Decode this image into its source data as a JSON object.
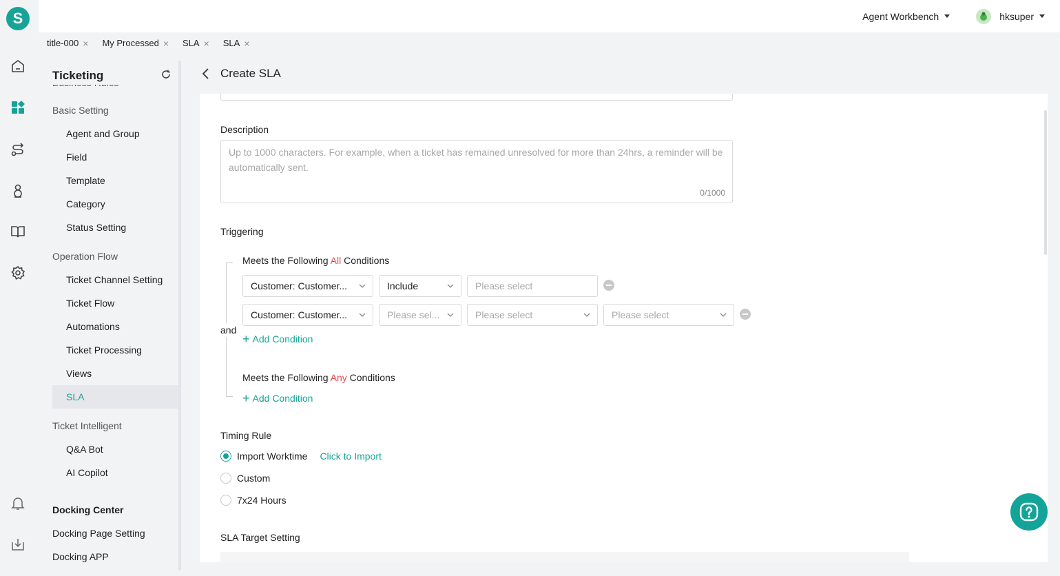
{
  "app": {
    "logo_letter": "S"
  },
  "rail": {
    "icons": [
      "home-icon",
      "dashboard-icon",
      "route-icon",
      "user-group-icon",
      "book-icon",
      "gear-icon",
      "bell-icon",
      "download-icon"
    ]
  },
  "topbar": {
    "workbench_label": "Agent Workbench",
    "username": "hksuper"
  },
  "tabs": [
    {
      "label": "title-000"
    },
    {
      "label": "My Processed"
    },
    {
      "label": "SLA"
    },
    {
      "label": "SLA"
    }
  ],
  "sidebar": {
    "title": "Ticketing",
    "cut_item": "Business Rules",
    "groups": [
      {
        "label": "Basic Setting",
        "items": [
          "Agent and Group",
          "Field",
          "Template",
          "Category",
          "Status Setting"
        ]
      },
      {
        "label": "Operation Flow",
        "items": [
          "Ticket Channel Setting",
          "Ticket Flow",
          "Automations",
          "Ticket Processing",
          "Views",
          "SLA"
        ]
      },
      {
        "label": "Ticket Intelligent",
        "items": [
          "Q&A Bot",
          "AI Copilot"
        ]
      }
    ],
    "docking_title": "Docking Center",
    "docking_items": [
      "Docking Page Setting",
      "Docking APP"
    ]
  },
  "page": {
    "title": "Create SLA",
    "description_label": "Description",
    "description_placeholder": "Up to 1000 characters. For example, when a ticket has remained unresolved for more than 24hrs, a reminder will be automatically sent.",
    "description_counter": "0/1000",
    "triggering_label": "Triggering",
    "all_prefix": "Meets the Following ",
    "all_word": "All",
    "all_suffix": " Conditions",
    "any_prefix": "Meets the Following ",
    "any_word": "Any",
    "any_suffix": " Conditions",
    "and_label": "and",
    "condition1": {
      "field": "Customer: Customer...",
      "operator": "Include",
      "value_placeholder": "Please select"
    },
    "condition2": {
      "field": "Customer: Customer...",
      "operator_placeholder": "Please sel...",
      "value_placeholder": "Please select",
      "value2_placeholder": "Please select"
    },
    "add_condition_label": "Add Condition",
    "timing_rule_label": "Timing Rule",
    "timing_options": [
      {
        "label": "Import Worktime",
        "checked": true
      },
      {
        "label": "Custom",
        "checked": false
      },
      {
        "label": "7x24 Hours",
        "checked": false
      }
    ],
    "click_to_import": "Click to Import",
    "sla_target_label": "SLA Target Setting"
  },
  "colors": {
    "accent": "#17a398",
    "highlight": "#e5484d"
  }
}
